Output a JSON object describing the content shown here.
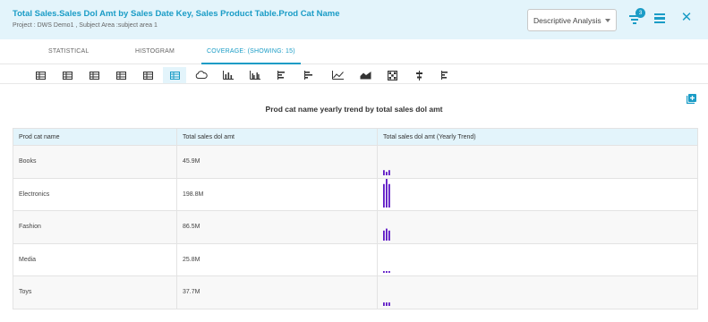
{
  "header": {
    "title": "Total Sales.Sales Dol Amt by Sales Date Key, Sales Product Table.Prod Cat Name",
    "subtitle": "Project : DWS Demo1 ,  Subject Area :subject area 1",
    "analysis_select": "Descriptive Analysis",
    "filter_count": "3"
  },
  "tabs": [
    {
      "label": "STATISTICAL"
    },
    {
      "label": "HISTOGRAM"
    },
    {
      "label": "COVERAGE: (SHOWING: 15)"
    }
  ],
  "toolbar": {
    "icons": [
      "table-icon",
      "table-icon",
      "table-icon",
      "table-icon",
      "table-icon",
      "table-trend-icon",
      "cloud-icon",
      "bar-chart-icon",
      "grouped-bar-icon",
      "horizontal-bar-icon",
      "horizontal-bar-icon",
      "line-chart-icon",
      "area-chart-icon",
      "heatmap-icon",
      "dot-plot-icon",
      "horizontal-bar-icon"
    ],
    "active_index": 5
  },
  "chart_title": "Prod cat name yearly trend by total sales dol amt",
  "table": {
    "columns": [
      "Prod cat name",
      "Total sales dol amt",
      "Total sales dol amt (Yearly Trend)"
    ],
    "rows": [
      {
        "name": "Books",
        "total": "45.9M",
        "trend": [
          0.18,
          0.12,
          0.18
        ]
      },
      {
        "name": "Electronics",
        "total": "198.8M",
        "trend": [
          0.82,
          1.0,
          0.82
        ]
      },
      {
        "name": "Fashion",
        "total": "86.5M",
        "trend": [
          0.35,
          0.42,
          0.35
        ]
      },
      {
        "name": "Media",
        "total": "25.8M",
        "trend": [
          0.06,
          0.06,
          0.06
        ]
      },
      {
        "name": "Toys",
        "total": "37.7M",
        "trend": [
          0.12,
          0.12,
          0.12
        ]
      }
    ]
  },
  "colors": {
    "accent": "#1a9cc6",
    "header_bg": "#e3f4fb",
    "spark": "#5c16c5"
  }
}
